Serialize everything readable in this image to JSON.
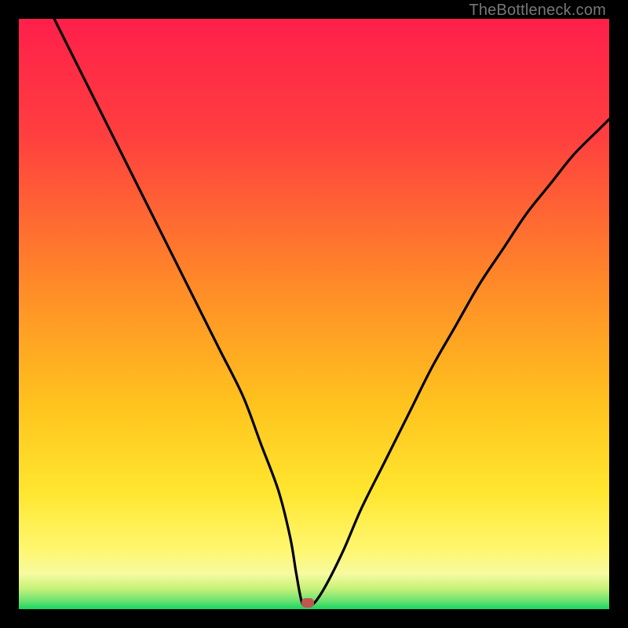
{
  "watermark": "TheBottleneck.com",
  "colors": {
    "frame": "#000000",
    "curve": "#000000",
    "marker": "#c1564e",
    "gradient_stops": [
      {
        "pos": 0.0,
        "color": "#ff1f4b"
      },
      {
        "pos": 0.2,
        "color": "#ff3f3f"
      },
      {
        "pos": 0.45,
        "color": "#ff8a28"
      },
      {
        "pos": 0.65,
        "color": "#ffc21e"
      },
      {
        "pos": 0.8,
        "color": "#ffe62e"
      },
      {
        "pos": 0.9,
        "color": "#fff770"
      },
      {
        "pos": 0.94,
        "color": "#f7faa0"
      },
      {
        "pos": 0.965,
        "color": "#c7f27a"
      },
      {
        "pos": 0.985,
        "color": "#6fe371"
      },
      {
        "pos": 1.0,
        "color": "#18d760"
      }
    ]
  },
  "chart_data": {
    "type": "line",
    "title": "",
    "xlabel": "",
    "ylabel": "",
    "xlim": [
      0,
      100
    ],
    "ylim": [
      0,
      100
    ],
    "legend": false,
    "grid": false,
    "min_x": 48,
    "marker": {
      "x": 49,
      "y": 1
    },
    "series": [
      {
        "name": "bottleneck-curve",
        "x": [
          6,
          10,
          14,
          18,
          22,
          26,
          30,
          34,
          38,
          41,
          44,
          46,
          47,
          48,
          49,
          50,
          52,
          55,
          58,
          62,
          66,
          70,
          74,
          78,
          82,
          86,
          90,
          94,
          98,
          100
        ],
        "values": [
          100,
          92,
          84,
          76,
          68,
          60,
          52,
          44,
          36,
          28,
          20,
          12,
          6,
          1,
          1,
          1,
          4,
          10,
          17,
          25,
          33,
          41,
          48,
          55,
          61,
          67,
          72,
          77,
          81,
          83
        ]
      }
    ]
  }
}
